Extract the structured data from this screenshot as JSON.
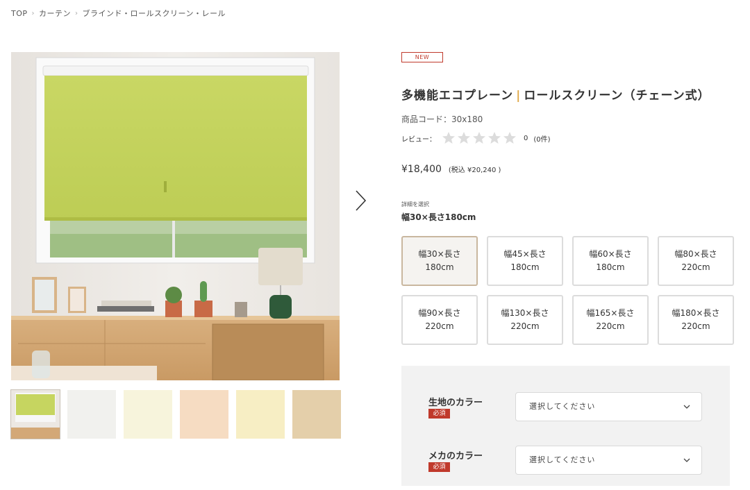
{
  "breadcrumb": [
    "TOP",
    "カーテン",
    "ブラインド・ロールスクリーン・レール"
  ],
  "product": {
    "badge": "NEW",
    "title_left": "多機能エコプレーン",
    "title_sep": "|",
    "title_right": "ロールスクリーン（チェーン式）",
    "code": "商品コード：30x180",
    "review_label": "レビュー：",
    "rating": 0,
    "review_count": "0",
    "review_paren": "(0件)",
    "price": "¥18,400",
    "price_tax": "(税込 ¥20,240 )"
  },
  "options": {
    "caption": "詳細を選択",
    "selected_label": "幅30×長さ180cm",
    "sizes": [
      {
        "label": "幅30×長さ180cm",
        "selected": true
      },
      {
        "label": "幅45×長さ180cm",
        "selected": false
      },
      {
        "label": "幅60×長さ180cm",
        "selected": false
      },
      {
        "label": "幅80×長さ220cm",
        "selected": false
      },
      {
        "label": "幅90×長さ220cm",
        "selected": false
      },
      {
        "label": "幅130×長さ220cm",
        "selected": false
      },
      {
        "label": "幅165×長さ220cm",
        "selected": false
      },
      {
        "label": "幅180×長さ220cm",
        "selected": false
      }
    ]
  },
  "selects": [
    {
      "label": "生地のカラー",
      "required": "必須",
      "placeholder": "選択してください"
    },
    {
      "label": "メカのカラー",
      "required": "必須",
      "placeholder": "選択してください"
    }
  ],
  "thumbnail_colors": [
    "#f1f1ee",
    "#f7f4dc",
    "#f6dcc2",
    "#f7eec4",
    "#e4cfaa"
  ],
  "colors": {
    "accent_red": "#c0392b",
    "title_bar": "#e0a94a",
    "screen_green": "#c4d35c"
  }
}
